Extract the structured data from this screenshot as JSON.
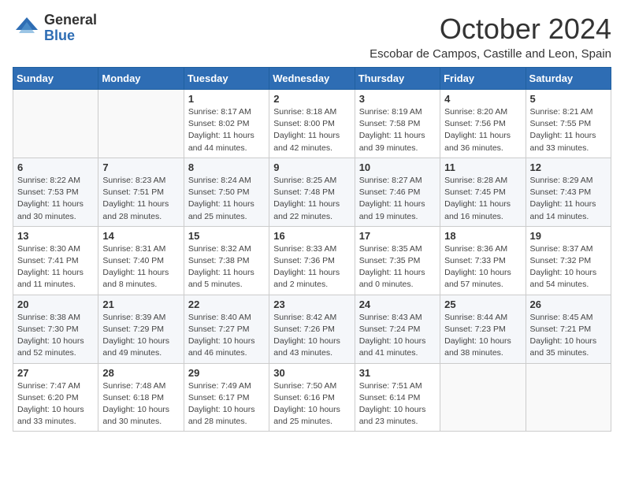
{
  "logo": {
    "general": "General",
    "blue": "Blue"
  },
  "title": "October 2024",
  "location": "Escobar de Campos, Castille and Leon, Spain",
  "weekdays": [
    "Sunday",
    "Monday",
    "Tuesday",
    "Wednesday",
    "Thursday",
    "Friday",
    "Saturday"
  ],
  "weeks": [
    [
      {
        "day": "",
        "info": ""
      },
      {
        "day": "",
        "info": ""
      },
      {
        "day": "1",
        "info": "Sunrise: 8:17 AM\nSunset: 8:02 PM\nDaylight: 11 hours and 44 minutes."
      },
      {
        "day": "2",
        "info": "Sunrise: 8:18 AM\nSunset: 8:00 PM\nDaylight: 11 hours and 42 minutes."
      },
      {
        "day": "3",
        "info": "Sunrise: 8:19 AM\nSunset: 7:58 PM\nDaylight: 11 hours and 39 minutes."
      },
      {
        "day": "4",
        "info": "Sunrise: 8:20 AM\nSunset: 7:56 PM\nDaylight: 11 hours and 36 minutes."
      },
      {
        "day": "5",
        "info": "Sunrise: 8:21 AM\nSunset: 7:55 PM\nDaylight: 11 hours and 33 minutes."
      }
    ],
    [
      {
        "day": "6",
        "info": "Sunrise: 8:22 AM\nSunset: 7:53 PM\nDaylight: 11 hours and 30 minutes."
      },
      {
        "day": "7",
        "info": "Sunrise: 8:23 AM\nSunset: 7:51 PM\nDaylight: 11 hours and 28 minutes."
      },
      {
        "day": "8",
        "info": "Sunrise: 8:24 AM\nSunset: 7:50 PM\nDaylight: 11 hours and 25 minutes."
      },
      {
        "day": "9",
        "info": "Sunrise: 8:25 AM\nSunset: 7:48 PM\nDaylight: 11 hours and 22 minutes."
      },
      {
        "day": "10",
        "info": "Sunrise: 8:27 AM\nSunset: 7:46 PM\nDaylight: 11 hours and 19 minutes."
      },
      {
        "day": "11",
        "info": "Sunrise: 8:28 AM\nSunset: 7:45 PM\nDaylight: 11 hours and 16 minutes."
      },
      {
        "day": "12",
        "info": "Sunrise: 8:29 AM\nSunset: 7:43 PM\nDaylight: 11 hours and 14 minutes."
      }
    ],
    [
      {
        "day": "13",
        "info": "Sunrise: 8:30 AM\nSunset: 7:41 PM\nDaylight: 11 hours and 11 minutes."
      },
      {
        "day": "14",
        "info": "Sunrise: 8:31 AM\nSunset: 7:40 PM\nDaylight: 11 hours and 8 minutes."
      },
      {
        "day": "15",
        "info": "Sunrise: 8:32 AM\nSunset: 7:38 PM\nDaylight: 11 hours and 5 minutes."
      },
      {
        "day": "16",
        "info": "Sunrise: 8:33 AM\nSunset: 7:36 PM\nDaylight: 11 hours and 2 minutes."
      },
      {
        "day": "17",
        "info": "Sunrise: 8:35 AM\nSunset: 7:35 PM\nDaylight: 11 hours and 0 minutes."
      },
      {
        "day": "18",
        "info": "Sunrise: 8:36 AM\nSunset: 7:33 PM\nDaylight: 10 hours and 57 minutes."
      },
      {
        "day": "19",
        "info": "Sunrise: 8:37 AM\nSunset: 7:32 PM\nDaylight: 10 hours and 54 minutes."
      }
    ],
    [
      {
        "day": "20",
        "info": "Sunrise: 8:38 AM\nSunset: 7:30 PM\nDaylight: 10 hours and 52 minutes."
      },
      {
        "day": "21",
        "info": "Sunrise: 8:39 AM\nSunset: 7:29 PM\nDaylight: 10 hours and 49 minutes."
      },
      {
        "day": "22",
        "info": "Sunrise: 8:40 AM\nSunset: 7:27 PM\nDaylight: 10 hours and 46 minutes."
      },
      {
        "day": "23",
        "info": "Sunrise: 8:42 AM\nSunset: 7:26 PM\nDaylight: 10 hours and 43 minutes."
      },
      {
        "day": "24",
        "info": "Sunrise: 8:43 AM\nSunset: 7:24 PM\nDaylight: 10 hours and 41 minutes."
      },
      {
        "day": "25",
        "info": "Sunrise: 8:44 AM\nSunset: 7:23 PM\nDaylight: 10 hours and 38 minutes."
      },
      {
        "day": "26",
        "info": "Sunrise: 8:45 AM\nSunset: 7:21 PM\nDaylight: 10 hours and 35 minutes."
      }
    ],
    [
      {
        "day": "27",
        "info": "Sunrise: 7:47 AM\nSunset: 6:20 PM\nDaylight: 10 hours and 33 minutes."
      },
      {
        "day": "28",
        "info": "Sunrise: 7:48 AM\nSunset: 6:18 PM\nDaylight: 10 hours and 30 minutes."
      },
      {
        "day": "29",
        "info": "Sunrise: 7:49 AM\nSunset: 6:17 PM\nDaylight: 10 hours and 28 minutes."
      },
      {
        "day": "30",
        "info": "Sunrise: 7:50 AM\nSunset: 6:16 PM\nDaylight: 10 hours and 25 minutes."
      },
      {
        "day": "31",
        "info": "Sunrise: 7:51 AM\nSunset: 6:14 PM\nDaylight: 10 hours and 23 minutes."
      },
      {
        "day": "",
        "info": ""
      },
      {
        "day": "",
        "info": ""
      }
    ]
  ]
}
